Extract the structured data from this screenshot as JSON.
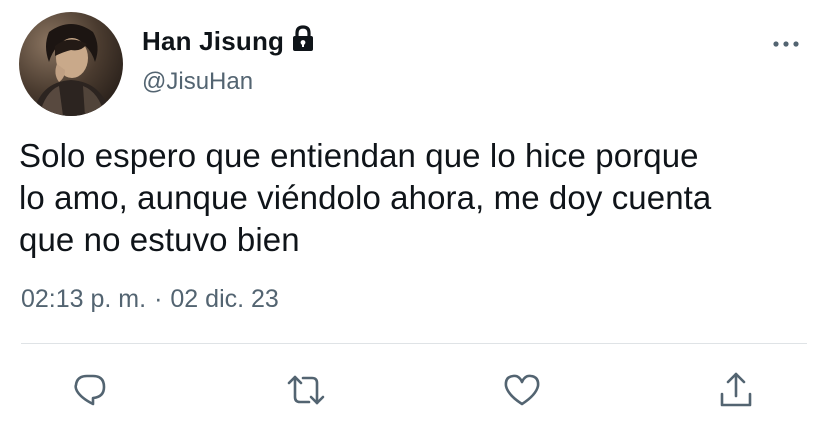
{
  "user": {
    "display_name": "Han Jisung",
    "handle": "@JisuHan",
    "protected_icon": "lock-icon",
    "avatar_icon": "profile-photo"
  },
  "tweet": {
    "text": "Solo espero que entiendan que lo hice porque\nlo amo, aunque viéndolo ahora, me doy cuenta\nque no estuvo bien",
    "time": "02:13 p. m.",
    "separator": "·",
    "date": "02 dic. 23"
  },
  "actions": {
    "reply_icon": "reply-icon",
    "retweet_icon": "retweet-icon",
    "like_icon": "like-icon",
    "share_icon": "share-icon",
    "more_icon": "more-icon"
  },
  "colors": {
    "text_primary": "#0f1419",
    "text_secondary": "#536471",
    "icon_gray": "#536471",
    "divider": "#dfe3e6"
  }
}
